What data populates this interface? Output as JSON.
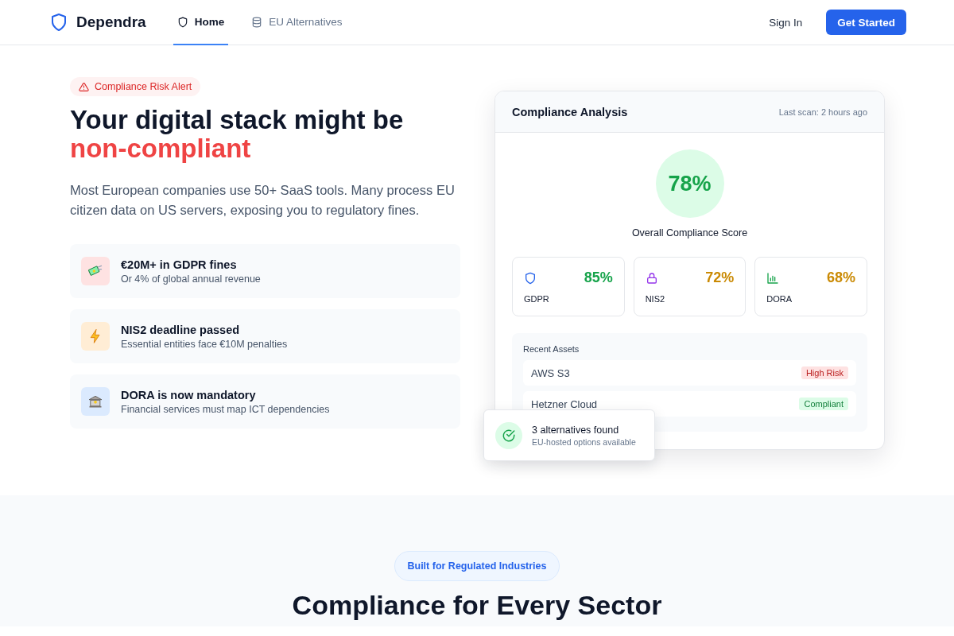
{
  "header": {
    "brand": "Dependra",
    "nav": [
      {
        "label": "Home",
        "selected": true
      },
      {
        "label": "EU Alternatives",
        "selected": false
      }
    ],
    "sign_in": "Sign In",
    "cta": "Get Started"
  },
  "hero": {
    "alert": "Compliance Risk Alert",
    "title_line1": "Your digital stack might be",
    "title_line2": "non-compliant",
    "subtitle": "Most European companies use 50+ SaaS tools. Many process EU citizen data on US servers, exposing you to regulatory fines.",
    "risks": [
      {
        "kind": "money",
        "title": "€20M+ in GDPR fines",
        "detail": "Or 4% of global annual revenue"
      },
      {
        "kind": "bolt",
        "title": "NIS2 deadline passed",
        "detail": "Essential entities face €10M penalties"
      },
      {
        "kind": "bank",
        "title": "DORA is now mandatory",
        "detail": "Financial services must map ICT dependencies"
      }
    ]
  },
  "analysis": {
    "title": "Compliance Analysis",
    "last_scan": "Last scan: 2 hours ago",
    "score": "78%",
    "score_label": "Overall Compliance Score",
    "frameworks": [
      {
        "name": "GDPR",
        "score": "85%",
        "color": "#16a34a"
      },
      {
        "name": "NIS2",
        "score": "72%",
        "color": "#ca8a04"
      },
      {
        "name": "DORA",
        "score": "68%",
        "color": "#ca8a04"
      }
    ],
    "assets_title": "Recent Assets",
    "assets": [
      {
        "name": "AWS S3",
        "status": "High Risk",
        "kind": "high-risk"
      },
      {
        "name": "Hetzner Cloud",
        "status": "Compliant",
        "kind": "compliant"
      }
    ],
    "toast": {
      "title": "3 alternatives found",
      "detail": "EU-hosted options available"
    }
  },
  "sectors": {
    "pill": "Built for Regulated Industries",
    "heading": "Compliance for Every Sector"
  }
}
